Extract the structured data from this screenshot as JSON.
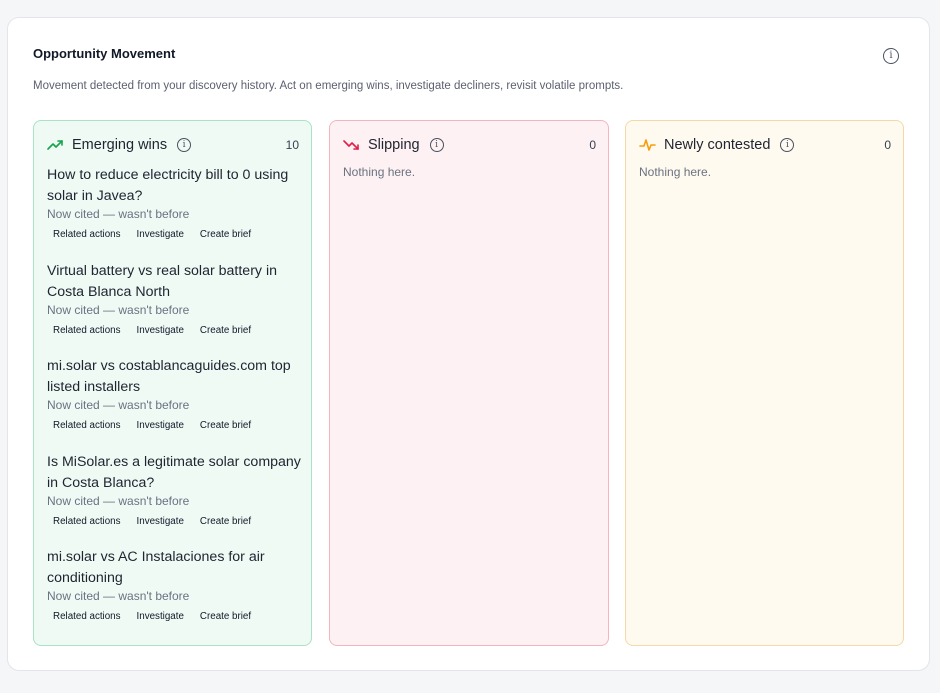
{
  "card": {
    "title": "Opportunity Movement",
    "subtitle": "Movement detected from your discovery history. Act on emerging wins, investigate decliners, revisit volatile prompts.",
    "info_icon": "info-icon"
  },
  "columns": {
    "emerging": {
      "title": "Emerging wins",
      "count": "10",
      "icon": "trending-up-icon",
      "accent": "#16a34a",
      "items": [
        {
          "question": "How to reduce electricity bill to 0 using solar in Javea?",
          "meta": "Now cited — wasn't before",
          "actions": [
            "Related actions",
            "Investigate",
            "Create brief"
          ]
        },
        {
          "question": "Virtual battery vs real solar battery in Costa Blanca North",
          "meta": "Now cited — wasn't before",
          "actions": [
            "Related actions",
            "Investigate",
            "Create brief"
          ]
        },
        {
          "question": "mi.solar vs costablancaguides.com top listed installers",
          "meta": "Now cited — wasn't before",
          "actions": [
            "Related actions",
            "Investigate",
            "Create brief"
          ]
        },
        {
          "question": "Is MiSolar.es a legitimate solar company in Costa Blanca?",
          "meta": "Now cited — wasn't before",
          "actions": [
            "Related actions",
            "Investigate",
            "Create brief"
          ]
        },
        {
          "question": "mi.solar vs AC Instalaciones for air conditioning",
          "meta": "Now cited — wasn't before",
          "actions": [
            "Related actions",
            "Investigate",
            "Create brief"
          ]
        }
      ]
    },
    "slipping": {
      "title": "Slipping",
      "count": "0",
      "icon": "trending-down-icon",
      "accent": "#e11d48",
      "empty": "Nothing here."
    },
    "contested": {
      "title": "Newly contested",
      "count": "0",
      "icon": "activity-icon",
      "accent": "#f59e0b",
      "empty": "Nothing here."
    }
  }
}
